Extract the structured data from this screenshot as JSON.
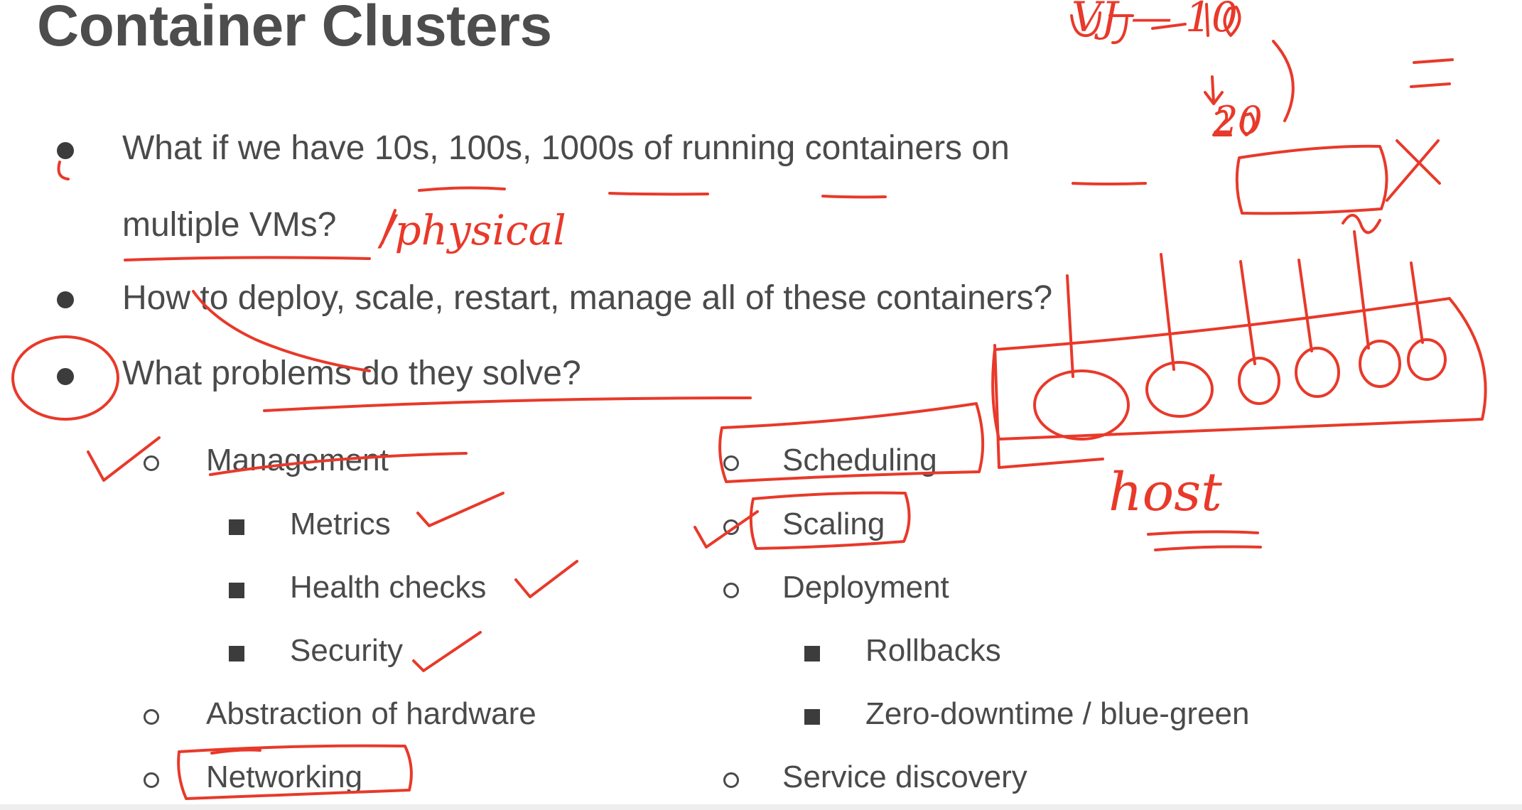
{
  "slide": {
    "title": "Container Clusters",
    "bullets": [
      "What if we have 10s, 100s, 1000s of running containers on",
      "multiple VMs?",
      "How to deploy, scale, restart, manage all of these containers?",
      "What problems do they solve?"
    ],
    "left_column": {
      "management": "Management",
      "metrics": "Metrics",
      "health_checks": "Health checks",
      "security": "Security",
      "abstraction": "Abstraction of hardware",
      "networking": "Networking"
    },
    "right_column": {
      "scheduling": "Scheduling",
      "scaling": "Scaling",
      "deployment": "Deployment",
      "rollbacks": "Rollbacks",
      "zero_downtime": "Zero-downtime / blue-green",
      "service_discovery": "Service discovery"
    }
  },
  "annotations": {
    "physical": "/physical",
    "host": "host",
    "top_note_1": "VJ — 10",
    "top_note_2": "20",
    "ink_color": "#e8392a"
  }
}
